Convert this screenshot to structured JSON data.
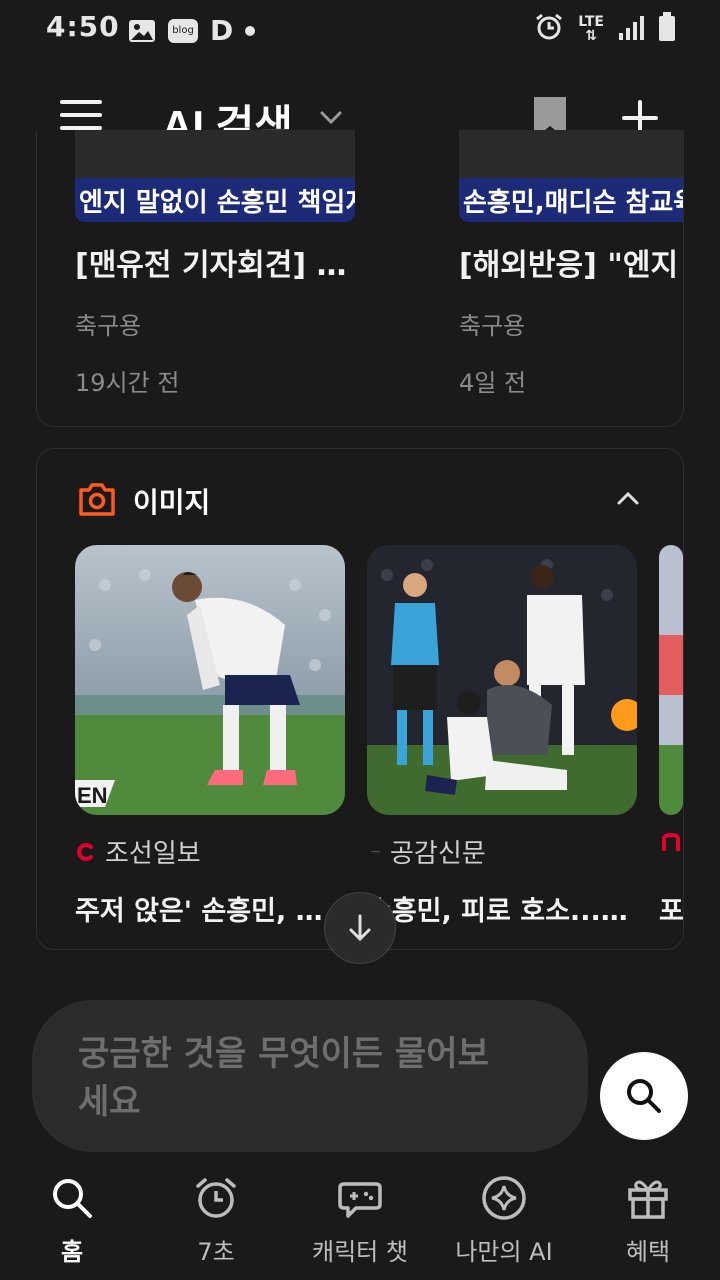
{
  "status_bar": {
    "time": "4:50",
    "blog_badge": "blog",
    "d_glyph": "D",
    "network": "LTE"
  },
  "header": {
    "title": "AI 검색"
  },
  "news": [
    {
      "caption": "엔지 말없이 손흥민 책임지겠단 이유",
      "title": "[맨유전 기자회견] \"손흥...",
      "source": "축구용",
      "time": "19시간 전"
    },
    {
      "caption": "손흥민,매디슨 참교육! 영",
      "title": "[해외반응] \"엔지",
      "source": "축구용",
      "time": "4일 전"
    }
  ],
  "images": {
    "header_label": "이미지",
    "items": [
      {
        "source": "조선일보",
        "title": "주저 앉은' 손흥민, 맨..."
      },
      {
        "source": "공감신문",
        "title": "손흥민, 피로 호소......"
      },
      {
        "source": "",
        "title": "포"
      }
    ]
  },
  "query": {
    "placeholder": "궁금한 것을 무엇이든 물어보세요"
  },
  "nav": {
    "items": [
      {
        "label": "홈"
      },
      {
        "label": "7초"
      },
      {
        "label": "캐릭터 챗"
      },
      {
        "label": "나만의 AI"
      },
      {
        "label": "혜택"
      }
    ]
  },
  "colors": {
    "background": "#1a1a1a",
    "accent_orange": "#ff5a1f",
    "chosun_red": "#e4002b",
    "caption_blue": "#1d2a78"
  }
}
